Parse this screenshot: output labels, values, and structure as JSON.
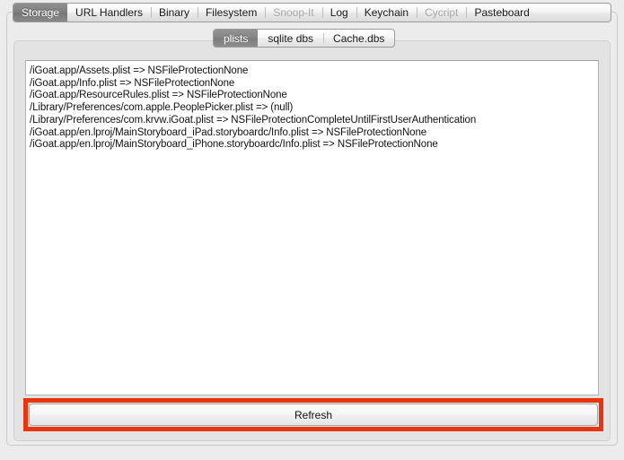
{
  "window": {
    "title": "Storage"
  },
  "main_tabs": [
    {
      "label": "Storage",
      "selected": true,
      "disabled": false
    },
    {
      "label": "URL Handlers",
      "selected": false,
      "disabled": false
    },
    {
      "label": "Binary",
      "selected": false,
      "disabled": false
    },
    {
      "label": "Filesystem",
      "selected": false,
      "disabled": false
    },
    {
      "label": "Snoop-It",
      "selected": false,
      "disabled": true
    },
    {
      "label": "Log",
      "selected": false,
      "disabled": false
    },
    {
      "label": "Keychain",
      "selected": false,
      "disabled": false
    },
    {
      "label": "Cycript",
      "selected": false,
      "disabled": true
    },
    {
      "label": "Pasteboard",
      "selected": false,
      "disabled": false
    }
  ],
  "sub_tabs": [
    {
      "label": "plists",
      "selected": true
    },
    {
      "label": "sqlite dbs",
      "selected": false
    },
    {
      "label": "Cache.dbs",
      "selected": false
    }
  ],
  "list": {
    "rows": [
      "/iGoat.app/Assets.plist => NSFileProtectionNone",
      "/iGoat.app/Info.plist => NSFileProtectionNone",
      "/iGoat.app/ResourceRules.plist => NSFileProtectionNone",
      "/Library/Preferences/com.apple.PeoplePicker.plist => (null)",
      "/Library/Preferences/com.krvw.iGoat.plist => NSFileProtectionCompleteUntilFirstUserAuthentication",
      "/iGoat.app/en.lproj/MainStoryboard_iPad.storyboardc/Info.plist => NSFileProtectionNone",
      "/iGoat.app/en.lproj/MainStoryboard_iPhone.storyboardc/Info.plist => NSFileProtectionNone"
    ]
  },
  "refresh": {
    "label": "Refresh"
  },
  "colors": {
    "highlight": "#e8350d",
    "selected_tab": "#7e7e7e",
    "window_background": "#ececec",
    "panel_background": "#e3e3e3",
    "list_background": "#ffffff"
  }
}
